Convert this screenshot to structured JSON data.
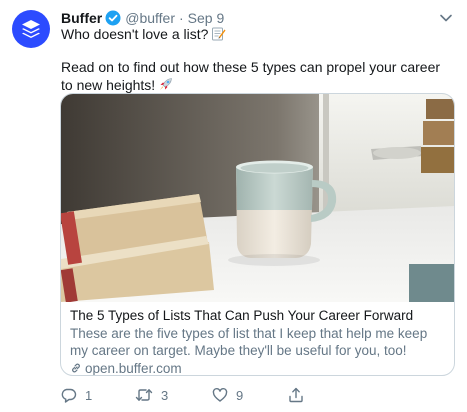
{
  "tweet": {
    "author_name": "Buffer",
    "handle": "@buffer",
    "separator": "·",
    "timestamp": "Sep 9",
    "text_line1": "Who doesn't love a list?",
    "text_line2": "Read on to find out how these 5 types can propel your career to new heights!",
    "icons": {
      "avatar": "buffer-logo-icon",
      "verified": "verified-badge-icon",
      "caret": "chevron-down-icon",
      "emoji1": "memo-emoji-icon",
      "emoji2": "rocket-emoji-icon"
    }
  },
  "card": {
    "title": "The 5 Types of Lists That Can Push Your Career Forward",
    "description": "These are the five types of list that I keep that help me keep my career on target. Maybe they'll be useful for you, too!",
    "link": "open.buffer.com"
  },
  "actions": {
    "reply_count": "1",
    "retweet_count": "3",
    "like_count": "9",
    "icons": [
      "reply-icon",
      "retweet-icon",
      "like-icon",
      "share-icon"
    ]
  },
  "colors": {
    "brand": "#2c4bff",
    "verified": "#1da1f2",
    "secondary_text": "#657786",
    "border": "#ccd6dd"
  }
}
